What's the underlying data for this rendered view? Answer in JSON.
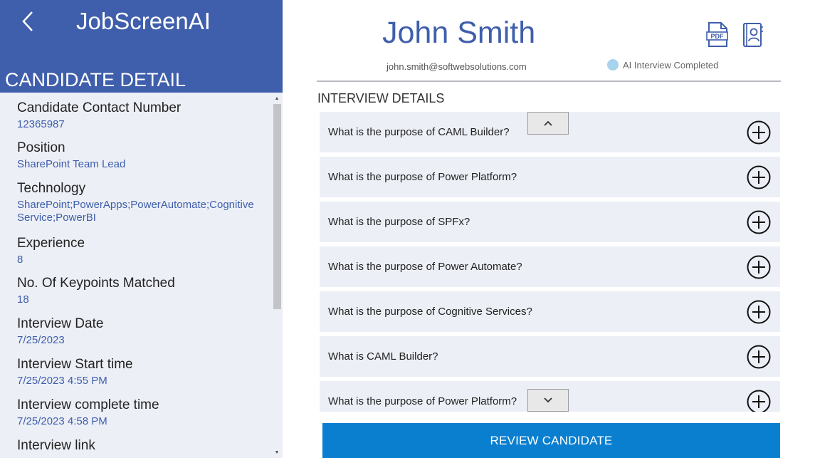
{
  "app": {
    "title": "JobScreenAI",
    "back_icon": "chevron-left-icon"
  },
  "left_panel": {
    "section_title": "CANDIDATE DETAIL",
    "fields": [
      {
        "label": "Candidate Contact Number",
        "value": "12365987"
      },
      {
        "label": "Position",
        "value": "SharePoint Team Lead"
      },
      {
        "label": "Technology",
        "value": "SharePoint;PowerApps;PowerAutomate;Cognitive Service;PowerBI"
      },
      {
        "label": "Experience",
        "value": "8"
      },
      {
        "label": "No. Of Keypoints Matched",
        "value": "18"
      },
      {
        "label": "Interview Date",
        "value": "7/25/2023"
      },
      {
        "label": "Interview Start time",
        "value": "7/25/2023 4:55 PM"
      },
      {
        "label": "Interview complete time",
        "value": "7/25/2023 4:58 PM"
      },
      {
        "label": "Interview link",
        "value": ""
      }
    ]
  },
  "candidate": {
    "name": "John Smith",
    "email": "john.smith@softwebsolutions.com",
    "status": "AI Interview Completed",
    "status_color": "#a7d3ec",
    "pdf_icon_label": "PDF"
  },
  "interview": {
    "title": "INTERVIEW DETAILS",
    "questions": [
      {
        "text": "What is the purpose of CAML Builder?"
      },
      {
        "text": "What is the purpose of Power Platform?"
      },
      {
        "text": "What is the purpose of SPFx?"
      },
      {
        "text": "What is the purpose of Power Automate?"
      },
      {
        "text": "What is the purpose of Cognitive Services?"
      },
      {
        "text": "What is CAML Builder?"
      },
      {
        "text": "What is the purpose of Power Platform?"
      }
    ]
  },
  "actions": {
    "review_label": "REVIEW CANDIDATE"
  },
  "colors": {
    "brand": "#3f5eac",
    "panel_bg": "#eceff6",
    "button": "#0a7fd0"
  }
}
